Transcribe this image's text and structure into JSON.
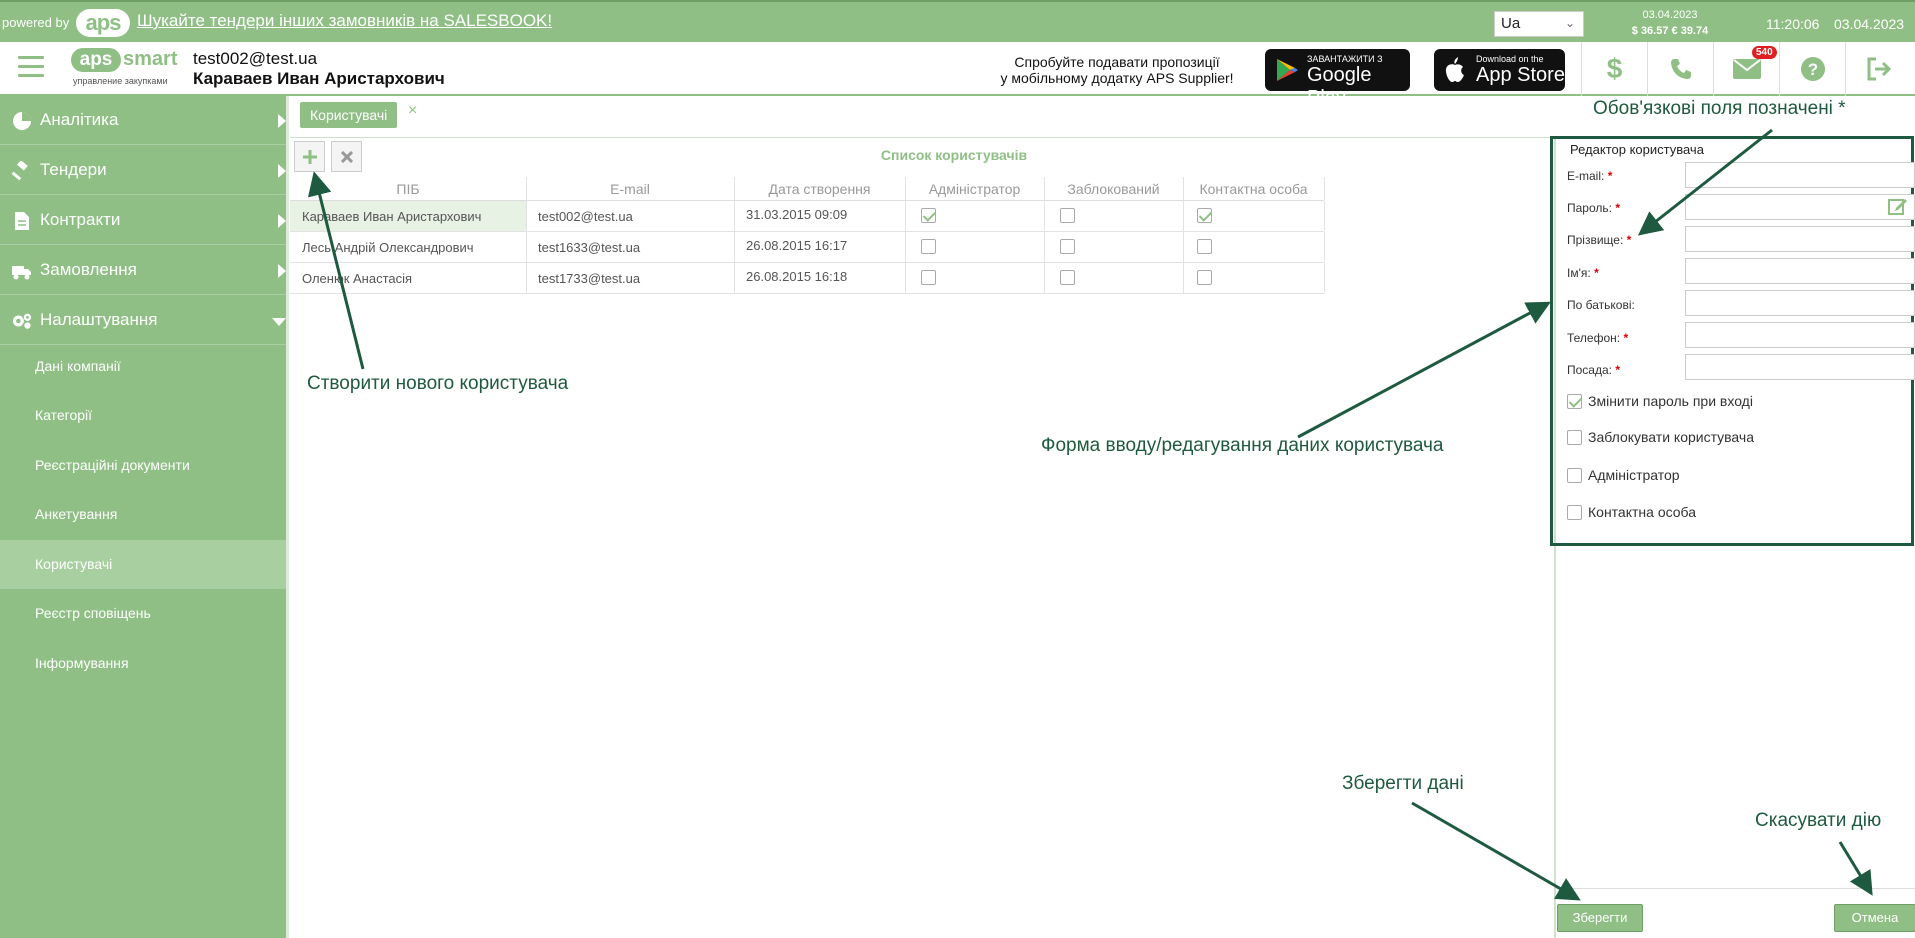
{
  "topbar": {
    "powered_by": "powered by",
    "logo_text": "aps",
    "promo_link": "Шукайте тендери інших замовників на SALESBOOK!",
    "language": "Ua",
    "rates_date": "03.04.2023",
    "rates_values": "$ 36.57  € 39.74",
    "time": "11:20:06",
    "date": "03.04.2023"
  },
  "header": {
    "brand_aps": "aps",
    "brand_smart": "smart",
    "brand_tagline": "управление закупками",
    "user_email": "test002@test.ua",
    "user_name": "Караваев Иван Аристархович",
    "mobile_promo_line1": "Спробуйте подавати пропозиції",
    "mobile_promo_line2": "у мобільному додатку APS Supplier!",
    "google_play_small": "ЗАВАНТАЖИТИ З",
    "google_play_big": "Google Play",
    "app_store_small": "Download on the",
    "app_store_big": "App Store",
    "mail_badge": "540",
    "icons": [
      "dollar-icon",
      "phone-icon",
      "mail-icon",
      "help-icon",
      "logout-icon"
    ]
  },
  "sidebar": {
    "items": [
      {
        "label": "Аналітика",
        "icon": "pie-chart-icon"
      },
      {
        "label": "Тендери",
        "icon": "gavel-icon"
      },
      {
        "label": "Контракти",
        "icon": "document-icon"
      },
      {
        "label": "Замовлення",
        "icon": "truck-icon"
      },
      {
        "label": "Налаштування",
        "icon": "gears-icon"
      }
    ],
    "subitems": [
      {
        "label": "Дані компанії"
      },
      {
        "label": "Категорії"
      },
      {
        "label": "Реєстраційні документи"
      },
      {
        "label": "Анкетування"
      },
      {
        "label": "Користувачі"
      },
      {
        "label": "Реєстр сповіщень"
      },
      {
        "label": "Інформування"
      }
    ]
  },
  "main": {
    "tab_label": "Користувачі",
    "tab_close": "×",
    "list_title": "Список користувачів",
    "columns": [
      "ПІБ",
      "E-mail",
      "Дата створення",
      "Адміністратор",
      "Заблокований",
      "Контактна особа"
    ],
    "rows": [
      {
        "name": "Караваев Иван Аристархович",
        "email": "test002@test.ua",
        "created": "31.03.2015 09:09",
        "admin": true,
        "blocked": false,
        "contact": true
      },
      {
        "name": "Лесь Андрій Олександрович",
        "email": "test1633@test.ua",
        "created": "26.08.2015 16:17",
        "admin": false,
        "blocked": false,
        "contact": false
      },
      {
        "name": "Оленюк Анастасія",
        "email": "test1733@test.ua",
        "created": "26.08.2015 16:18",
        "admin": false,
        "blocked": false,
        "contact": false
      }
    ]
  },
  "editor": {
    "legend": "Редактор користувача",
    "fields": [
      {
        "label": "E-mail:",
        "required": true,
        "value": ""
      },
      {
        "label": "Пароль:",
        "required": true,
        "value": ""
      },
      {
        "label": "Прізвище:",
        "required": true,
        "value": ""
      },
      {
        "label": "Ім'я:",
        "required": true,
        "value": ""
      },
      {
        "label": "По батькові:",
        "required": false,
        "value": ""
      },
      {
        "label": "Телефон:",
        "required": true,
        "value": ""
      },
      {
        "label": "Посада:",
        "required": true,
        "value": ""
      }
    ],
    "required_mark": "*",
    "checkboxes": [
      {
        "label": "Змінити пароль при вході",
        "checked": true
      },
      {
        "label": "Заблокувати користувача",
        "checked": false
      },
      {
        "label": "Адміністратор",
        "checked": false
      },
      {
        "label": "Контактна особа",
        "checked": false
      }
    ],
    "save_label": "Зберегти",
    "cancel_label": "Отмена"
  },
  "annotations": {
    "required_fields": "Обов'язкові поля позначені *",
    "create_user": "Створити нового користувача",
    "form_hint": "Форма вводу/редагування даних користувача",
    "save_hint": "Зберегти дані",
    "cancel_hint": "Скасувати дію"
  },
  "colors": {
    "brand_green": "#8fbf85",
    "annotation_green": "#1e5a3f",
    "required_red": "#d00000"
  }
}
